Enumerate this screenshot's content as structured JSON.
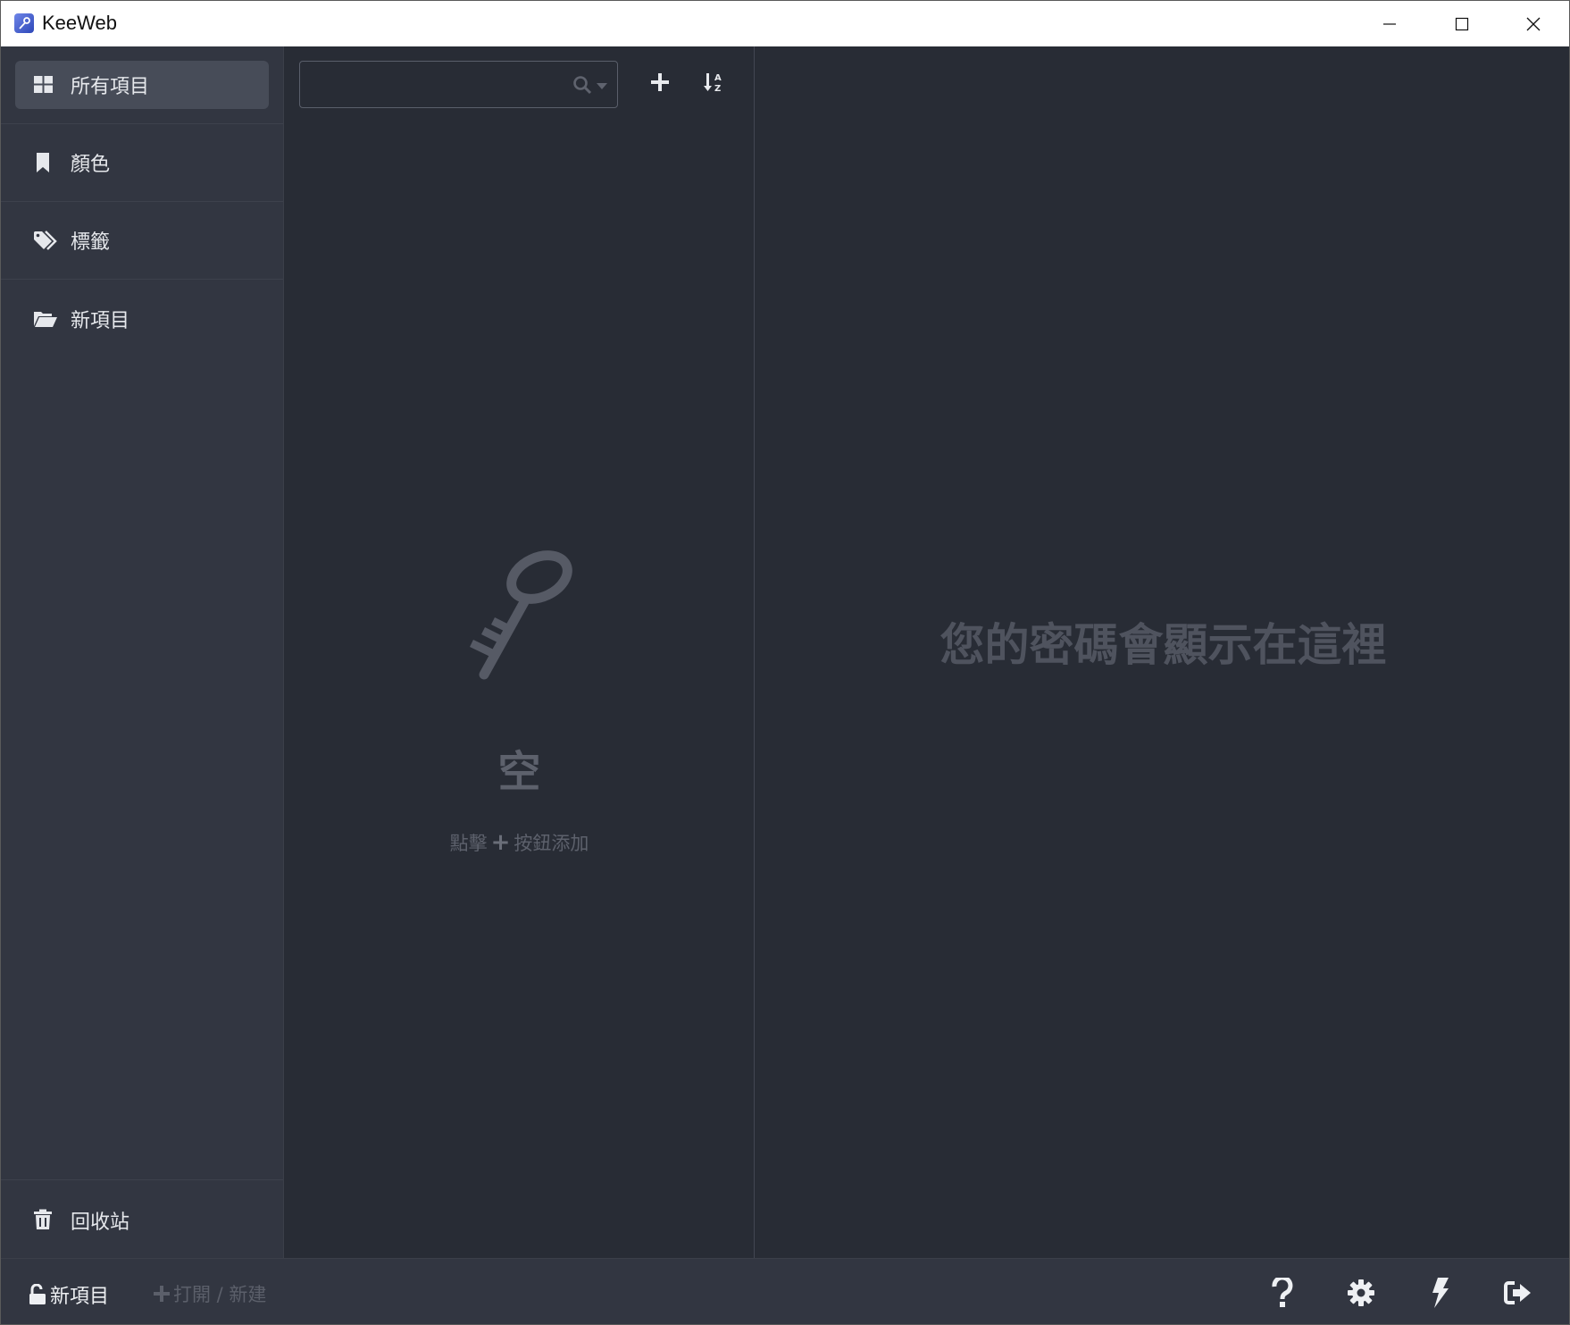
{
  "window": {
    "title": "KeeWeb"
  },
  "sidebar": {
    "items": [
      {
        "label": "所有項目",
        "icon": "grid-icon",
        "active": true
      },
      {
        "label": "顏色",
        "icon": "bookmark-icon"
      },
      {
        "label": "標籤",
        "icon": "tags-icon"
      },
      {
        "label": "新項目",
        "icon": "folder-open-icon"
      }
    ],
    "trash": {
      "label": "回收站",
      "icon": "trash-icon"
    }
  },
  "list": {
    "search": {
      "value": "",
      "placeholder": ""
    },
    "empty": {
      "title": "空",
      "hint_before": "點擊",
      "hint_after": "按鈕添加"
    }
  },
  "details": {
    "message": "您的密碼會顯示在這裡"
  },
  "footer": {
    "file_label": "新項目",
    "open_label": "打開 / 新建"
  }
}
